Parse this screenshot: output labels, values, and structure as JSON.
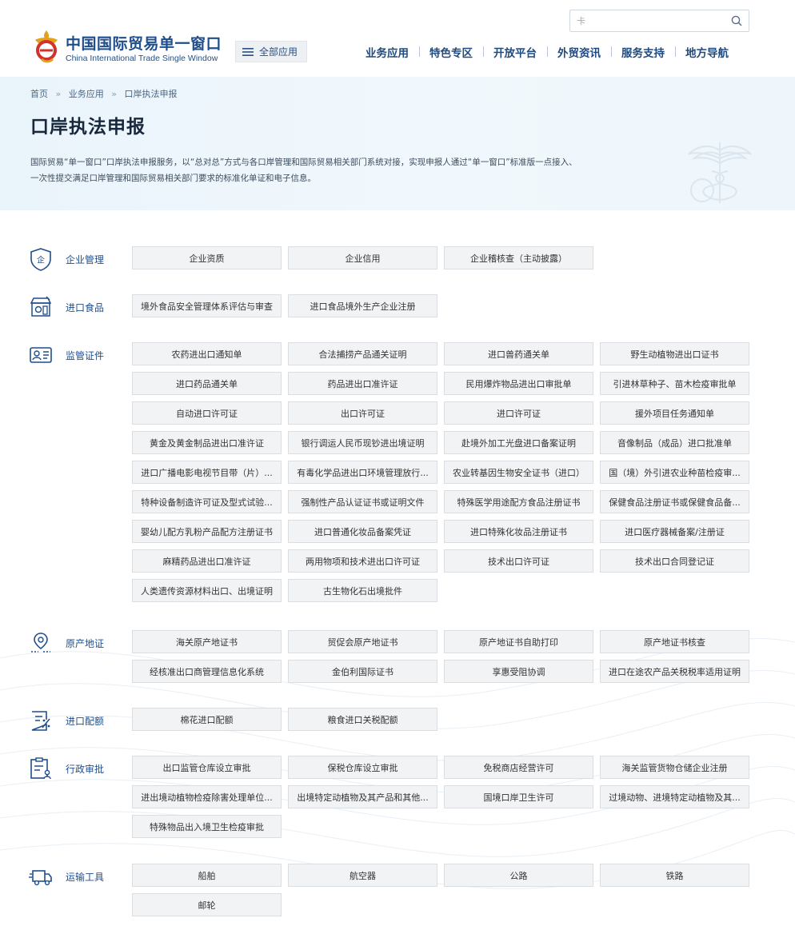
{
  "header": {
    "logo_cn": "中国国际贸易单一窗口",
    "logo_en": "China International Trade Single Window",
    "all_apps_label": "全部应用",
    "search_value": "卡",
    "nav": [
      "业务应用",
      "特色专区",
      "开放平台",
      "外贸资讯",
      "服务支持",
      "地方导航"
    ]
  },
  "banner": {
    "breadcrumb": [
      "首页",
      "业务应用",
      "口岸执法申报"
    ],
    "breadcrumb_sep": "»",
    "title": "口岸执法申报",
    "desc_line1": "国际贸易“单一窗口”口岸执法申报服务，以“总对总”方式与各口岸管理和国际贸易相关部门系统对接，实现申报人通过“单一窗口”标准版一点接入、",
    "desc_line2": "一次性提交满足口岸管理和国际贸易相关部门要求的标准化单证和电子信息。"
  },
  "sections": [
    {
      "title": "企业管理",
      "icon": "enterprise-shield-icon",
      "items": [
        "企业资质",
        "企业信用",
        "企业稽核查（主动披露）"
      ]
    },
    {
      "title": "进口食品",
      "icon": "food-store-icon",
      "items": [
        "境外食品安全管理体系评估与审查",
        "进口食品境外生产企业注册"
      ]
    },
    {
      "title": "监管证件",
      "icon": "id-card-icon",
      "items": [
        "农药进出口通知单",
        "合法捕捞产品通关证明",
        "进口兽药通关单",
        "野生动植物进出口证书",
        "进口药品通关单",
        "药品进出口准许证",
        "民用爆炸物品进出口审批单",
        "引进林草种子、苗木检疫审批单",
        "自动进口许可证",
        "出口许可证",
        "进口许可证",
        "援外项目任务通知单",
        "黄金及黄金制品进出口准许证",
        "银行调运人民币现钞进出境证明",
        "赴境外加工光盘进口备案证明",
        "音像制品（成品）进口批准单",
        "进口广播电影电视节目带（片）...",
        "有毒化学品进出口环境管理放行...",
        "农业转基因生物安全证书（进口）",
        "国（境）外引进农业种苗检疫审...",
        "特种设备制造许可证及型式试验...",
        "强制性产品认证证书或证明文件",
        "特殊医学用途配方食品注册证书",
        "保健食品注册证书或保健食品备...",
        "婴幼儿配方乳粉产品配方注册证书",
        "进口普通化妆品备案凭证",
        "进口特殊化妆品注册证书",
        "进口医疗器械备案/注册证",
        "麻精药品进出口准许证",
        "两用物项和技术进出口许可证",
        "技术出口许可证",
        "技术出口合同登记证",
        "人类遗传资源材料出口、出境证明",
        "古生物化石出境批件"
      ]
    },
    {
      "title": "原产地证",
      "icon": "location-pin-icon",
      "items": [
        "海关原产地证书",
        "贸促会原产地证书",
        "原产地证书自助打印",
        "原产地证书核查",
        "经核准出口商管理信息化系统",
        "金伯利国际证书",
        "享惠受阻协调",
        "进口在途农产品关税税率适用证明"
      ]
    },
    {
      "title": "进口配额",
      "icon": "quota-form-icon",
      "items": [
        "棉花进口配额",
        "粮食进口关税配额"
      ]
    },
    {
      "title": "行政审批",
      "icon": "approval-clipboard-icon",
      "items": [
        "出口监管仓库设立审批",
        "保税仓库设立审批",
        "免税商店经营许可",
        "海关监管货物仓储企业注册",
        "进出境动植物检疫除害处理单位...",
        "出境特定动植物及其产品和其他...",
        "国境口岸卫生许可",
        "过境动物、进境特定动植物及其...",
        "特殊物品出入境卫生检疫审批"
      ]
    },
    {
      "title": "运输工具",
      "icon": "delivery-truck-icon",
      "items": [
        "船舶",
        "航空器",
        "公路",
        "铁路",
        "邮轮"
      ]
    }
  ]
}
